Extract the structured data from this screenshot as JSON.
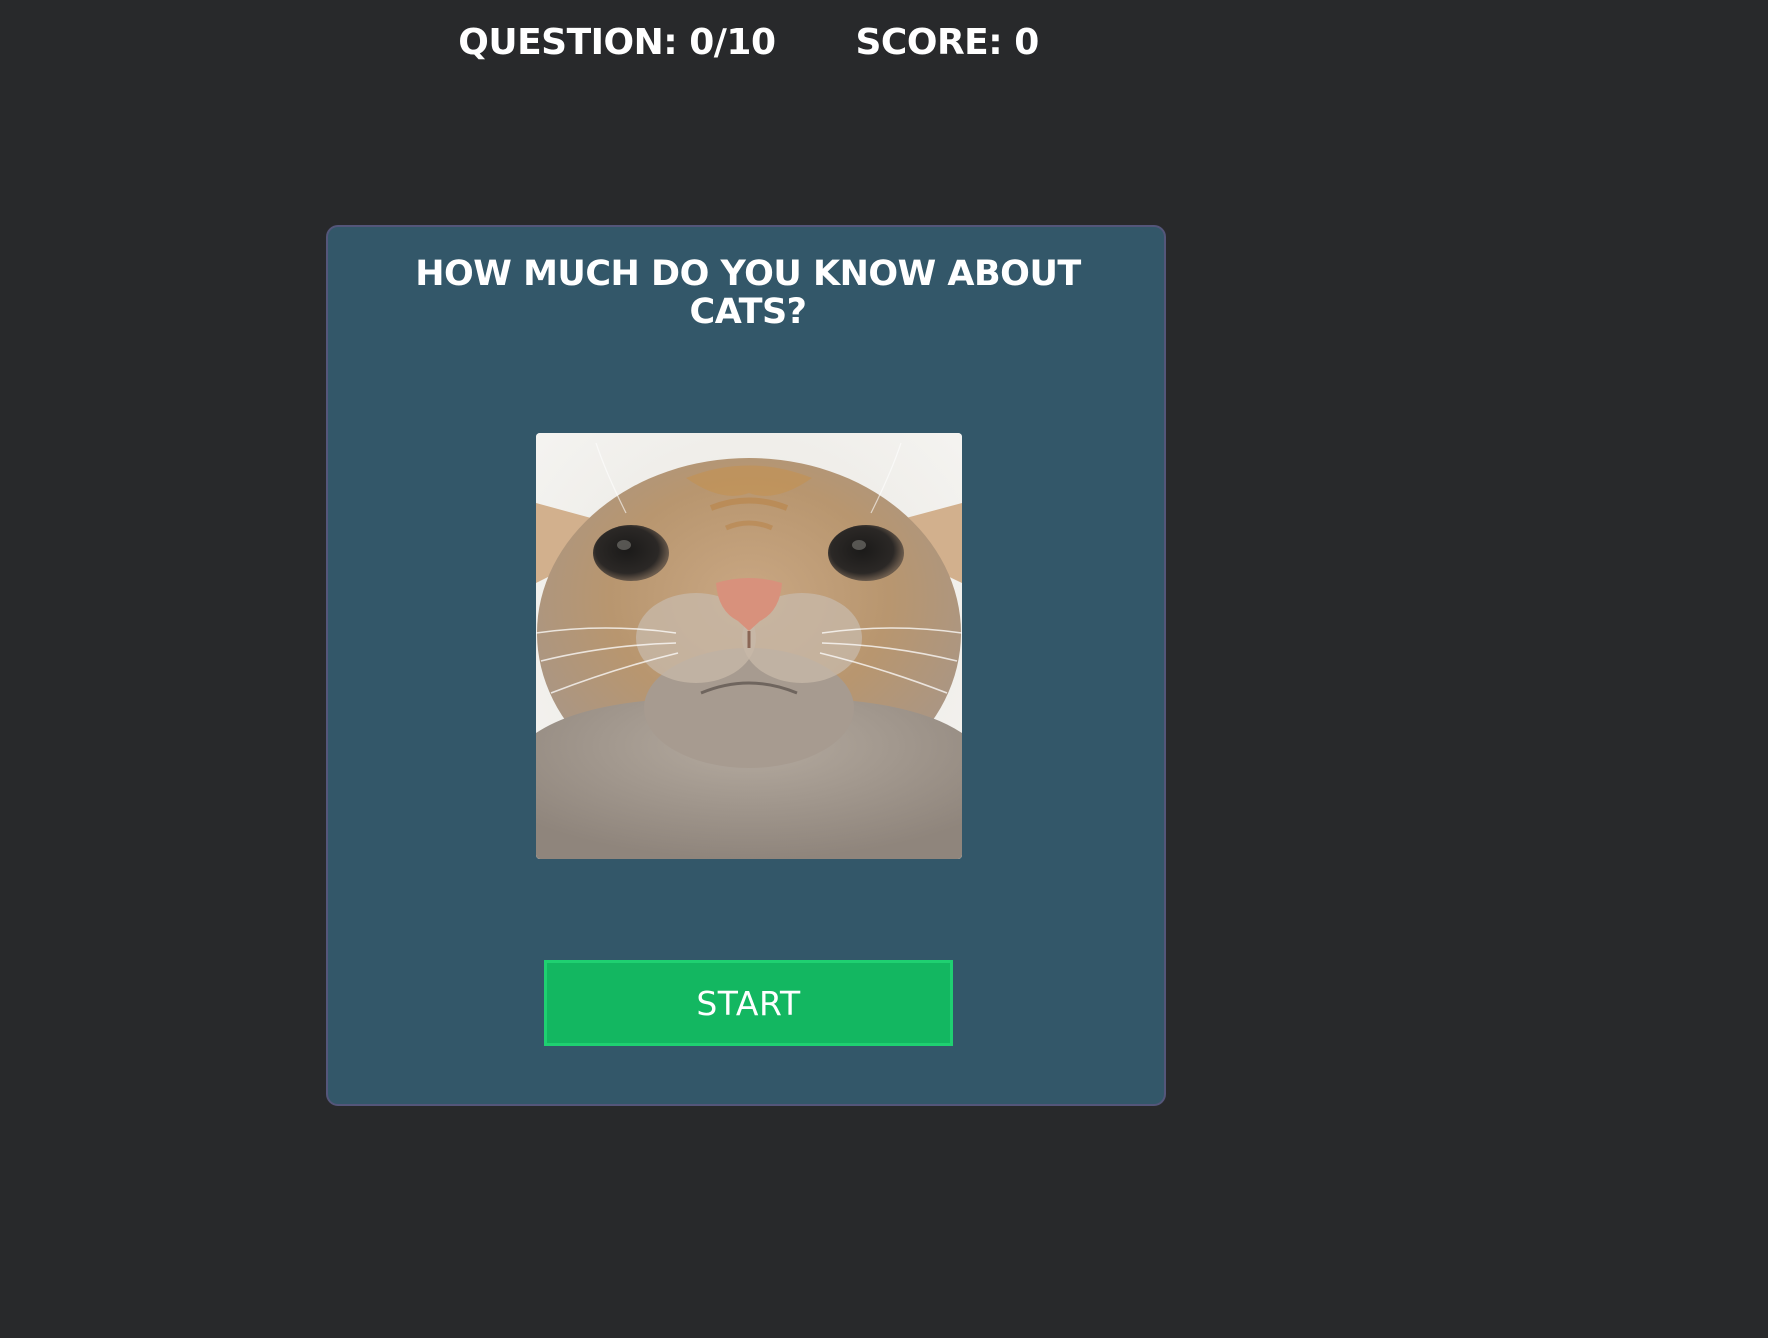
{
  "header": {
    "question_label": "QUESTION: 0/10",
    "score_label": "SCORE: 0"
  },
  "quiz": {
    "title": "HOW MUCH DO YOU KNOW ABOUT CATS?",
    "image_subject": "cat-face-photo",
    "start_label": "START"
  },
  "colors": {
    "page_background": "#28292b",
    "card_background": "#335769",
    "card_border": "#54567a",
    "start_button": "#13b761",
    "text": "#ffffff"
  }
}
